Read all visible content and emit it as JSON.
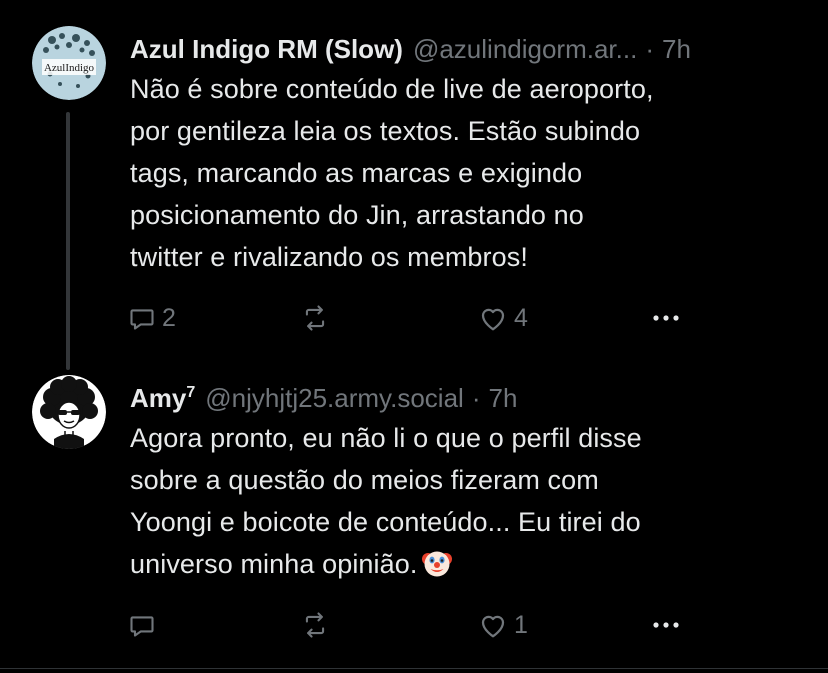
{
  "tweets": [
    {
      "author_name": "Azul Indigo RM (Slow)",
      "handle": "@azulindigorm.ar...",
      "separator": "·",
      "time": "7h",
      "avatar_text": [
        "Azul",
        "Indigo"
      ],
      "text_lines": [
        "Não é sobre conteúdo de live de aeroporto,",
        "por gentileza leia os textos. Estão subindo",
        "tags, marcando as marcas e exigindo",
        "posicionamento do Jin, arrastando no",
        "twitter e rivalizando os membros!"
      ],
      "reply_count": "2",
      "retweet_count": "",
      "like_count": "4"
    },
    {
      "author_name": "Amy",
      "author_sup": "7",
      "handle": "@njyhjtj25.army.social",
      "separator": "·",
      "time": "7h",
      "text_lines": [
        "Agora pronto, eu não li o que o perfil disse",
        "sobre a questão do meios fizeram com",
        "Yoongi e boicote de conteúdo... Eu tirei  do",
        "universo minha opinião."
      ],
      "reply_count": "",
      "retweet_count": "",
      "like_count": "1"
    }
  ],
  "icons": {
    "reply": "reply-icon",
    "retweet": "retweet-icon",
    "like": "heart-icon",
    "more": "more-icon",
    "emoji": "clown-face-emoji"
  },
  "colors": {
    "background": "#000000",
    "text": "#e7e9ea",
    "muted": "#71767b",
    "thread_line": "#333639"
  }
}
